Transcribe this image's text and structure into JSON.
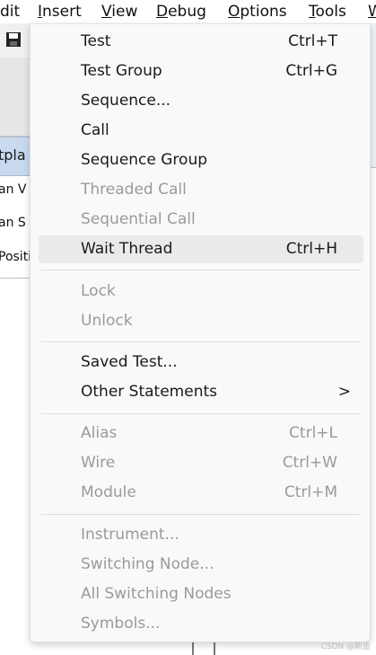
{
  "menubar": {
    "items": [
      {
        "pre": "",
        "u": "",
        "post": "dit"
      },
      {
        "pre": "",
        "u": "I",
        "post": "nsert"
      },
      {
        "pre": "",
        "u": "V",
        "post": "iew"
      },
      {
        "pre": "",
        "u": "D",
        "post": "ebug"
      },
      {
        "pre": "",
        "u": "O",
        "post": "ptions"
      },
      {
        "pre": "",
        "u": "T",
        "post": "ools"
      },
      {
        "pre": "",
        "u": "W",
        "post": ""
      }
    ]
  },
  "background": {
    "tab_text": "tpla",
    "rows": [
      "an V",
      "an S",
      "Positi"
    ]
  },
  "menu": {
    "items": [
      {
        "label": "Test",
        "shortcut": "Ctrl+T",
        "enabled": true
      },
      {
        "label": "Test Group",
        "shortcut": "Ctrl+G",
        "enabled": true
      },
      {
        "label": "Sequence...",
        "shortcut": "",
        "enabled": true
      },
      {
        "label": "Call",
        "shortcut": "",
        "enabled": true
      },
      {
        "label": "Sequence Group",
        "shortcut": "",
        "enabled": true
      },
      {
        "label": "Threaded Call",
        "shortcut": "",
        "enabled": false
      },
      {
        "label": "Sequential Call",
        "shortcut": "",
        "enabled": false
      },
      {
        "label": "Wait Thread",
        "shortcut": "Ctrl+H",
        "enabled": true,
        "highlighted": true
      },
      {
        "label": "Lock",
        "shortcut": "",
        "enabled": false
      },
      {
        "label": "Unlock",
        "shortcut": "",
        "enabled": false
      },
      {
        "label": "Saved Test...",
        "shortcut": "",
        "enabled": true
      },
      {
        "label": "Other Statements",
        "shortcut": "",
        "enabled": true,
        "submenu_arrow": ">"
      },
      {
        "label": "Alias",
        "shortcut": "Ctrl+L",
        "enabled": false
      },
      {
        "label": "Wire",
        "shortcut": "Ctrl+W",
        "enabled": false
      },
      {
        "label": "Module",
        "shortcut": "Ctrl+M",
        "enabled": false
      },
      {
        "label": "Instrument...",
        "shortcut": "",
        "enabled": false
      },
      {
        "label": "Switching Node...",
        "shortcut": "",
        "enabled": false
      },
      {
        "label": "All Switching Nodes",
        "shortcut": "",
        "enabled": false
      },
      {
        "label": "Symbols...",
        "shortcut": "",
        "enabled": false
      }
    ]
  },
  "watermark": "CSDN @斯金"
}
